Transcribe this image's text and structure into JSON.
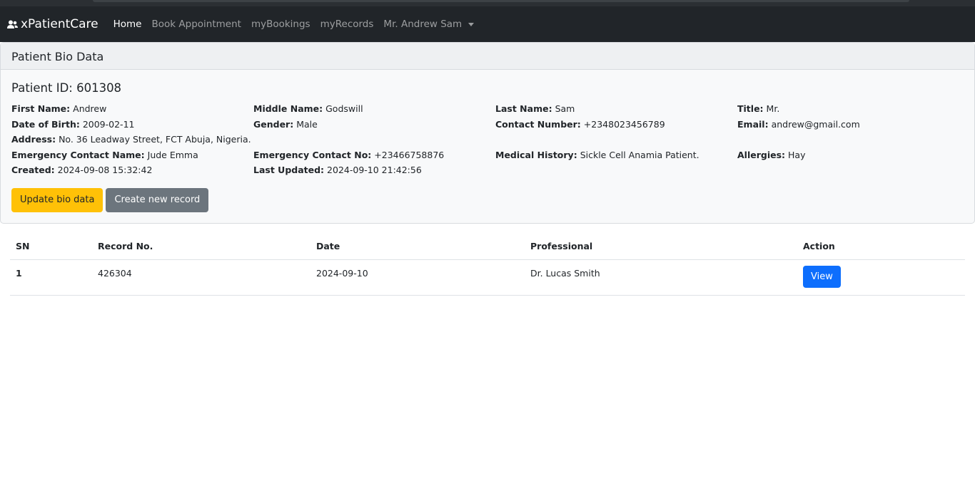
{
  "navbar": {
    "brand": "xPatientCare",
    "items": [
      {
        "label": "Home",
        "active": true
      },
      {
        "label": "Book Appointment"
      },
      {
        "label": "myBookings"
      },
      {
        "label": "myRecords"
      }
    ],
    "user_menu": "Mr. Andrew Sam"
  },
  "card": {
    "header": "Patient Bio Data",
    "patient_id": "Patient ID: 601308",
    "fields": {
      "first_name": {
        "label": "First Name:",
        "value": "Andrew"
      },
      "middle_name": {
        "label": "Middle Name:",
        "value": "Godswill"
      },
      "last_name": {
        "label": "Last Name:",
        "value": "Sam"
      },
      "title": {
        "label": "Title:",
        "value": "Mr."
      },
      "dob": {
        "label": "Date of Birth:",
        "value": "2009-02-11"
      },
      "gender": {
        "label": "Gender:",
        "value": "Male"
      },
      "contact": {
        "label": "Contact Number:",
        "value": "+2348023456789"
      },
      "email": {
        "label": "Email:",
        "value": "andrew@gmail.com"
      },
      "address": {
        "label": "Address:",
        "value": "No. 36 Leadway Street, FCT Abuja, Nigeria."
      },
      "emergency_name": {
        "label": "Emergency Contact Name:",
        "value": "Jude Emma"
      },
      "emergency_no": {
        "label": "Emergency Contact No:",
        "value": "+23466758876"
      },
      "medical_history": {
        "label": "Medical History:",
        "value": "Sickle Cell Anamia Patient."
      },
      "allergies": {
        "label": "Allergies:",
        "value": "Hay"
      },
      "created": {
        "label": "Created:",
        "value": "2024-09-08 15:32:42"
      },
      "updated": {
        "label": "Last Updated:",
        "value": "2024-09-10 21:42:56"
      }
    },
    "update_button": "Update bio data",
    "create_button": "Create new record"
  },
  "table": {
    "headers": [
      "SN",
      "Record No.",
      "Date",
      "Professional",
      "Action"
    ],
    "rows": [
      {
        "sn": "1",
        "record_no": "426304",
        "date": "2024-09-10",
        "professional": "Dr. Lucas Smith",
        "action": "View"
      }
    ]
  },
  "colors": {
    "navbar": "#212529",
    "warning": "#ffc107",
    "secondary": "#6c757d",
    "primary": "#0d6efd"
  }
}
